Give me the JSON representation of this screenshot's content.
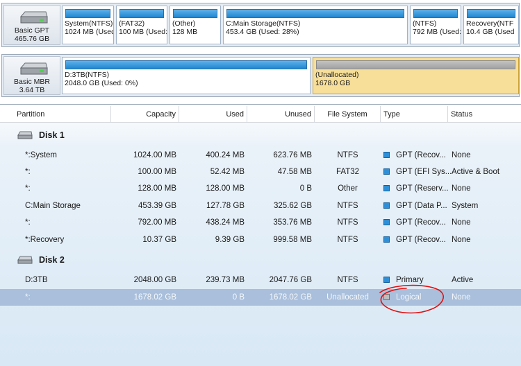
{
  "disks": [
    {
      "info": {
        "line1": "Basic GPT",
        "line2": "465.76 GB"
      },
      "partitions": [
        {
          "line1": "System(NTFS)",
          "line2": "1024 MB (Used",
          "bar": "used"
        },
        {
          "line1": "(FAT32)",
          "line2": "100 MB (Used:",
          "bar": "used"
        },
        {
          "line1": "(Other)",
          "line2": "128 MB",
          "bar": "used"
        },
        {
          "line1": "C:Main Storage(NTFS)",
          "line2": "453.4 GB (Used: 28%)",
          "bar": "used"
        },
        {
          "line1": "(NTFS)",
          "line2": "792 MB (Used:",
          "bar": "used"
        },
        {
          "line1": "Recovery(NTF",
          "line2": "10.4 GB (Used",
          "bar": "used"
        }
      ]
    },
    {
      "info": {
        "line1": "Basic MBR",
        "line2": "3.64 TB"
      },
      "partitions": [
        {
          "line1": "D:3TB(NTFS)",
          "line2": "2048.0 GB (Used: 0%)",
          "bar": "used"
        },
        {
          "line1": "(Unallocated)",
          "line2": "1678.0 GB",
          "bar": "unallocated"
        }
      ]
    }
  ],
  "columns": {
    "partition": "Partition",
    "capacity": "Capacity",
    "used": "Used",
    "unused": "Unused",
    "filesystem": "File System",
    "type": "Type",
    "status": "Status"
  },
  "groups": [
    {
      "label": "Disk 1",
      "rows": [
        {
          "partition": "*:System",
          "capacity": "1024.00 MB",
          "used": "400.24 MB",
          "unused": "623.76 MB",
          "filesystem": "NTFS",
          "type": "GPT (Recov...",
          "status": "None"
        },
        {
          "partition": "*:",
          "capacity": "100.00 MB",
          "used": "52.42 MB",
          "unused": "47.58 MB",
          "filesystem": "FAT32",
          "type": "GPT (EFI Sys...",
          "status": "Active & Boot"
        },
        {
          "partition": "*:",
          "capacity": "128.00 MB",
          "used": "128.00 MB",
          "unused": "0 B",
          "filesystem": "Other",
          "type": "GPT (Reserv...",
          "status": "None"
        },
        {
          "partition": "C:Main Storage",
          "capacity": "453.39 GB",
          "used": "127.78 GB",
          "unused": "325.62 GB",
          "filesystem": "NTFS",
          "type": "GPT (Data P...",
          "status": "System"
        },
        {
          "partition": "*:",
          "capacity": "792.00 MB",
          "used": "438.24 MB",
          "unused": "353.76 MB",
          "filesystem": "NTFS",
          "type": "GPT (Recov...",
          "status": "None"
        },
        {
          "partition": "*:Recovery",
          "capacity": "10.37 GB",
          "used": "9.39 GB",
          "unused": "999.58 MB",
          "filesystem": "NTFS",
          "type": "GPT (Recov...",
          "status": "None"
        }
      ]
    },
    {
      "label": "Disk 2",
      "rows": [
        {
          "partition": "D:3TB",
          "capacity": "2048.00 GB",
          "used": "239.73 MB",
          "unused": "2047.76 GB",
          "filesystem": "NTFS",
          "type": "Primary",
          "status": "Active"
        },
        {
          "partition": "*:",
          "capacity": "1678.02 GB",
          "used": "0 B",
          "unused": "1678.02 GB",
          "filesystem": "Unallocated",
          "type": "Logical",
          "status": "None",
          "selected": true
        }
      ]
    }
  ],
  "colors": {
    "type_primary": "#2d8fd8",
    "type_unallocated": "#bdbdbd",
    "selection": "#a9bfdb",
    "annotation": "#e01010"
  }
}
